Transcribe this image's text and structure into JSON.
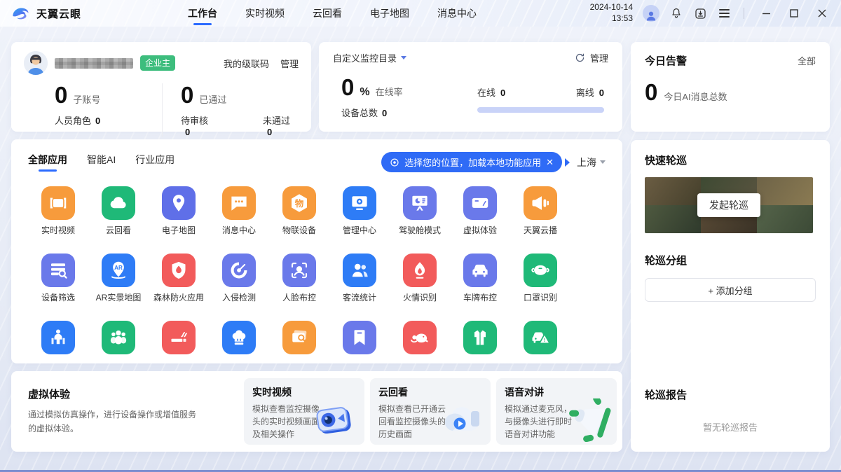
{
  "topbar": {
    "brand": "天翼云眼",
    "nav": [
      {
        "label": "工作台",
        "active": true
      },
      {
        "label": "实时视频",
        "active": false
      },
      {
        "label": "云回看",
        "active": false
      },
      {
        "label": "电子地图",
        "active": false
      },
      {
        "label": "消息中心",
        "active": false
      }
    ],
    "date": "2024-10-14",
    "time": "13:53",
    "icons": [
      "logo-swoosh-icon",
      "user-avatar-icon",
      "bell-icon",
      "download-icon",
      "menu-icon",
      "minimize-icon",
      "maximize-icon",
      "close-icon"
    ]
  },
  "account_card": {
    "badge": "企业主",
    "link_cascade": "我的级联码",
    "link_manage": "管理",
    "sub_account": {
      "value": "0",
      "label": "子账号"
    },
    "role": {
      "label": "人员角色",
      "value": "0"
    },
    "approved": {
      "value": "0",
      "label": "已通过"
    },
    "pending": {
      "label": "待审核",
      "value": "0"
    },
    "rejected": {
      "label": "未通过",
      "value": "0"
    }
  },
  "monitor_card": {
    "title": "自定义监控目录",
    "manage": "管理",
    "online_rate": {
      "value": "0",
      "unit": "%",
      "label": "在线率"
    },
    "device_total": {
      "label": "设备总数",
      "value": "0"
    },
    "online": {
      "label": "在线",
      "value": "0"
    },
    "offline": {
      "label": "离线",
      "value": "0"
    },
    "progress_color": "#c9d3f8"
  },
  "alarm_card": {
    "title": "今日告警",
    "all_link": "全部",
    "count": "0",
    "label": "今日AI消息总数"
  },
  "apps_card": {
    "tabs": [
      {
        "label": "全部应用",
        "active": true
      },
      {
        "label": "智能AI",
        "active": false
      },
      {
        "label": "行业应用",
        "active": false
      }
    ],
    "tooltip_text": "选择您的位置，加载本地功能应用",
    "tooltip_color": "#2f6bf6",
    "city": "上海",
    "apps": [
      {
        "label": "实时视频",
        "color": "#f79b3c",
        "icon": "video"
      },
      {
        "label": "云回看",
        "color": "#1fb978",
        "icon": "cloud"
      },
      {
        "label": "电子地图",
        "color": "#5f6fe8",
        "icon": "pin"
      },
      {
        "label": "消息中心",
        "color": "#f79b3c",
        "icon": "chat"
      },
      {
        "label": "物联设备",
        "color": "#f79b3c",
        "icon": "iot"
      },
      {
        "label": "管理中心",
        "color": "#2e7cf6",
        "icon": "monitor"
      },
      {
        "label": "驾驶舱模式",
        "color": "#6a79ea",
        "icon": "dashboard"
      },
      {
        "label": "虚拟体验",
        "color": "#6a79ea",
        "icon": "vr"
      },
      {
        "label": "天翼云播",
        "color": "#f79b3c",
        "icon": "broadcast"
      },
      {
        "label": "设备筛选",
        "color": "#6a79ea",
        "icon": "filter"
      },
      {
        "label": "AR实景地图",
        "color": "#2e7cf6",
        "icon": "ar"
      },
      {
        "label": "森林防火应用",
        "color": "#f25b5b",
        "icon": "shieldflame"
      },
      {
        "label": "入侵检测",
        "color": "#6a79ea",
        "icon": "radar"
      },
      {
        "label": "人脸布控",
        "color": "#6a79ea",
        "icon": "face"
      },
      {
        "label": "客流统计",
        "color": "#2e7cf6",
        "icon": "people"
      },
      {
        "label": "火情识别",
        "color": "#f25b5b",
        "icon": "flame"
      },
      {
        "label": "车牌布控",
        "color": "#6a79ea",
        "icon": "car"
      },
      {
        "label": "口罩识别",
        "color": "#1fb978",
        "icon": "mask"
      },
      {
        "label": "",
        "color": "#2e7cf6",
        "icon": "scooter"
      },
      {
        "label": "",
        "color": "#1fb978",
        "icon": "group"
      },
      {
        "label": "",
        "color": "#f25b5b",
        "icon": "cigarette"
      },
      {
        "label": "",
        "color": "#2e7cf6",
        "icon": "chef"
      },
      {
        "label": "",
        "color": "#f79b3c",
        "icon": "photo"
      },
      {
        "label": "",
        "color": "#6a79ea",
        "icon": "bookmark"
      },
      {
        "label": "",
        "color": "#f25b5b",
        "icon": "mouse"
      },
      {
        "label": "",
        "color": "#1fb978",
        "icon": "uniform"
      },
      {
        "label": "",
        "color": "#1fb978",
        "icon": "caralert"
      }
    ]
  },
  "bottom_card": {
    "title": "虚拟体验",
    "desc": "通过模拟仿真操作，进行设备操作或增值服务的虚拟体验。",
    "features": [
      {
        "title": "实时视频",
        "desc": "模拟查看监控摄像头的实时视频画面及相关操作",
        "image": "camera3d"
      },
      {
        "title": "云回看",
        "desc": "模拟查看已开通云回看监控摄像头的历史画面",
        "image": "cloud3d"
      },
      {
        "title": "语音对讲",
        "desc": "模拟通过麦克风，与摄像头进行即时语音对讲功能",
        "image": "megaphone3d"
      }
    ]
  },
  "patrol": {
    "quick_title": "快速轮巡",
    "start_button": "发起轮巡",
    "group_title": "轮巡分组",
    "add_group_button": "+ 添加分组",
    "report_title": "轮巡报告",
    "report_empty": "暂无轮巡报告"
  }
}
